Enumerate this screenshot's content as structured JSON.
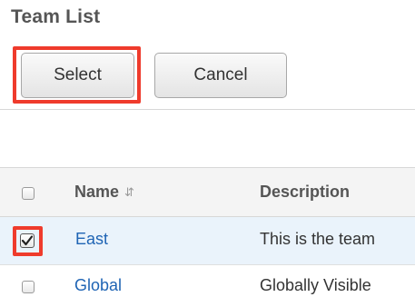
{
  "title": "Team List",
  "buttons": {
    "select": "Select",
    "cancel": "Cancel"
  },
  "table": {
    "columns": {
      "name": "Name",
      "description": "Description"
    },
    "rows": [
      {
        "name": "East",
        "description": "This is the team",
        "checked": true
      },
      {
        "name": "Global",
        "description": "Globally Visible",
        "checked": false
      }
    ]
  },
  "colors": {
    "highlight": "#ef3b2c",
    "link": "#1f64b4",
    "selected_row": "#eaf3fb"
  }
}
